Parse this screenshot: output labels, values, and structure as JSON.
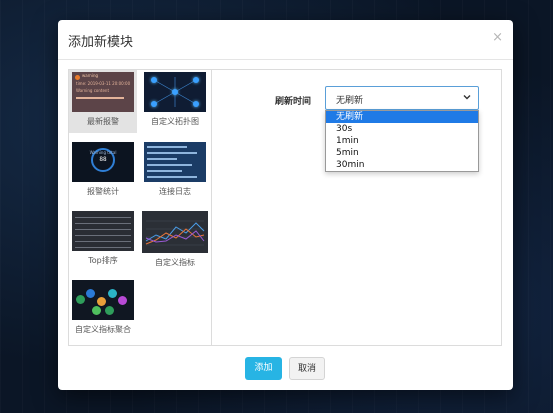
{
  "modal": {
    "title": "添加新模块",
    "close": "×"
  },
  "modules": [
    {
      "label": "最新报警",
      "thumb": "alarm-thumbnail",
      "selected": true,
      "thumb_text": [
        "warning",
        "time: 2019-03-11 20:00:00",
        "Warning content"
      ]
    },
    {
      "label": "自定义拓扑图",
      "thumb": "topology-thumbnail"
    },
    {
      "label": "报警统计",
      "thumb": "alarm-stats-thumbnail",
      "thumb_text": [
        "Warning total",
        "88"
      ]
    },
    {
      "label": "连接日志",
      "thumb": "connection-log-thumbnail"
    },
    {
      "label": "Top排序",
      "thumb": "top-sort-thumbnail"
    },
    {
      "label": "自定义指标",
      "thumb": "custom-metric-thumbnail"
    },
    {
      "label": "自定义指标聚合",
      "thumb": "metric-aggregate-thumbnail"
    }
  ],
  "form": {
    "refresh_label": "刷新时间",
    "selected_value": "无刷新",
    "options": [
      "无刷新",
      "30s",
      "1min",
      "5min",
      "30min"
    ],
    "highlighted_index": 0
  },
  "footer": {
    "add_label": "添加",
    "cancel_label": "取消"
  },
  "colors": {
    "accent": "#27b4e4",
    "highlight": "#1f7ae6",
    "select_border": "#5a9fd8"
  }
}
